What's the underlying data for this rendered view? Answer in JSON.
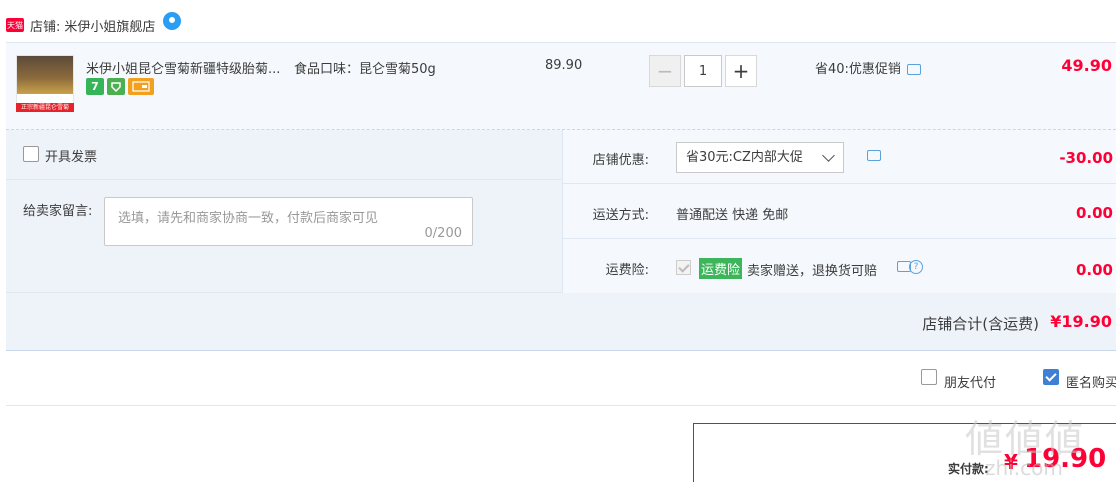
{
  "shop": {
    "badge": "天猫",
    "label": "店铺:",
    "name": "米伊小姐旗舰店"
  },
  "item": {
    "thumb_banner": "正宗新疆昆仑雪菊",
    "title": "米伊小姐昆仑雪菊新疆特级胎菊...",
    "sku": "食品口味：昆仑雪菊50g",
    "service_icons": [
      "7",
      "guarantee-icon",
      "card-icon"
    ],
    "unit_price": "89.90",
    "quantity": "1",
    "minus_label": "−",
    "plus_label": "+",
    "promo": "省40:优惠促销",
    "total": "49.90"
  },
  "options": {
    "invoice_label": "开具发票",
    "message_label": "给卖家留言:",
    "message_placeholder": "选填，请先和商家协商一致，付款后商家可见",
    "message_count": "0/200",
    "shop_discount_label": "店铺优惠:",
    "shop_discount_value": "省30元:CZ内部大促",
    "shop_discount_amount": "-30.00",
    "shipping_label": "运送方式:",
    "shipping_value": "普通配送 快递 免邮",
    "shipping_amount": "0.00",
    "insurance_label": "运费险:",
    "insurance_badge": "运费险",
    "insurance_text": "卖家赠送，退换货可赔",
    "insurance_amount": "0.00"
  },
  "shop_total": {
    "label": "店铺合计(含运费)",
    "amount": "¥19.90"
  },
  "extras": {
    "friend_pay_label": "朋友代付",
    "anonymous_label": "匿名购买"
  },
  "payment": {
    "label": "实付款:",
    "currency": "¥",
    "amount": "19.90"
  },
  "watermark": {
    "text": "値値値",
    "sub": "zhi.com"
  },
  "colors": {
    "price_red": "#ff0036",
    "row_bg": "#f5f8fc",
    "panel_bg": "#eef3f9",
    "insurance_green": "#3db55a",
    "checkbox_blue": "#3e80d6"
  }
}
